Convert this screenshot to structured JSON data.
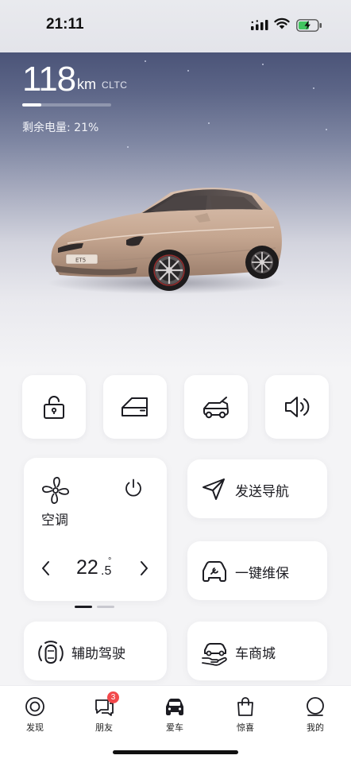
{
  "status_bar": {
    "time": "21:11"
  },
  "vehicle": {
    "range_value": "118",
    "range_unit": "km",
    "range_standard": "CLTC",
    "battery_label": "剩余电量: 21%",
    "battery_fraction": 0.21,
    "model_badge": "ET5"
  },
  "quick_controls": [
    {
      "name": "lock",
      "icon": "unlocked-padlock-icon"
    },
    {
      "name": "door",
      "icon": "car-door-icon"
    },
    {
      "name": "trunk",
      "icon": "trunk-icon"
    },
    {
      "name": "horn",
      "icon": "speaker-icon"
    }
  ],
  "climate": {
    "label": "空调",
    "temperature_int": "22",
    "temperature_dec": ".5",
    "temperature_unit": "°"
  },
  "actions": {
    "send_navigation": "发送导航",
    "service": "一键维保",
    "assisted_driving": "辅助驾驶",
    "car_store": "车商城"
  },
  "tabs": [
    {
      "label": "发现",
      "icon": "discover-icon"
    },
    {
      "label": "朋友",
      "icon": "chat-icon",
      "badge": "3"
    },
    {
      "label": "爱车",
      "icon": "car-icon",
      "active": true
    },
    {
      "label": "惊喜",
      "icon": "shopping-bag-icon"
    },
    {
      "label": "我的",
      "icon": "profile-icon"
    }
  ],
  "colors": {
    "badge": "#f2484b",
    "car_body": "#c8a892",
    "hero_top": "#4b5478"
  }
}
